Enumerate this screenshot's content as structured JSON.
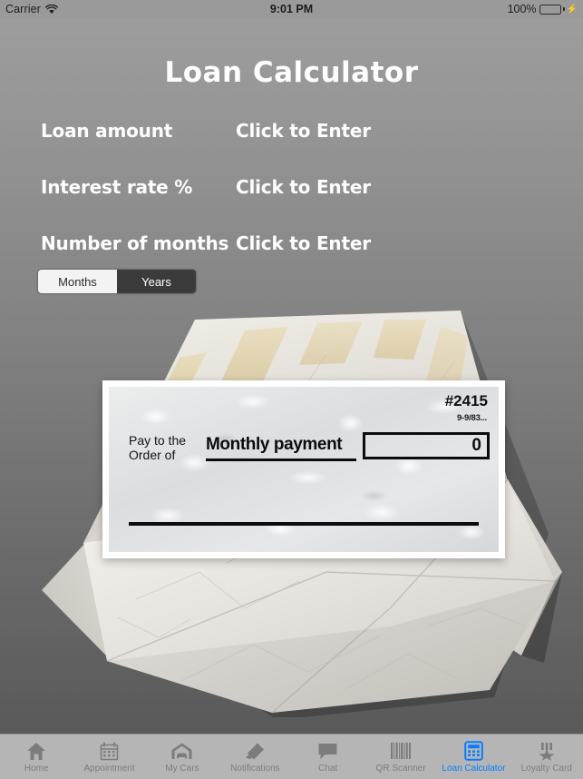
{
  "status_bar": {
    "carrier": "Carrier",
    "wifi_icon": "wifi-icon",
    "time": "9:01 PM",
    "battery_percent": "100%",
    "battery_icon": "battery-full-icon",
    "charging_icon": "lightning-bolt-icon",
    "battery_color": "#4ddb4d"
  },
  "screen": {
    "title": "Loan Calculator"
  },
  "form": {
    "rows": [
      {
        "label": "Loan amount",
        "value": "Click to Enter"
      },
      {
        "label": "Interest rate %",
        "value": "Click to Enter"
      },
      {
        "label": "Number of months",
        "value": "Click to Enter"
      }
    ]
  },
  "period_segment": {
    "options": [
      "Months",
      "Years"
    ],
    "selected": "Years",
    "months_label": "Months",
    "years_label": "Years"
  },
  "check": {
    "number": "#2415",
    "routing_fraction": "9-9/83...",
    "pay_to_line1": "Pay to the",
    "pay_to_line2": "Order of",
    "payee": "Monthly payment",
    "amount": "0",
    "envelope_image": "open-envelope-illustration"
  },
  "tab_bar": {
    "active_color": "#0a7cff",
    "inactive_color": "#7c7c7c",
    "tabs": [
      {
        "label": "Home",
        "icon": "home-icon",
        "active": false
      },
      {
        "label": "Appointment",
        "icon": "calendar-icon",
        "active": false
      },
      {
        "label": "My Cars",
        "icon": "garage-car-icon",
        "active": false
      },
      {
        "label": "Notifications",
        "icon": "megaphone-icon",
        "active": false
      },
      {
        "label": "Chat",
        "icon": "chat-bubble-icon",
        "active": false
      },
      {
        "label": "QR Scanner",
        "icon": "barcode-icon",
        "active": false
      },
      {
        "label": "Loan Calculator",
        "icon": "calculator-icon",
        "active": true
      },
      {
        "label": "Loyalty Card",
        "icon": "medal-star-icon",
        "active": false
      }
    ]
  }
}
